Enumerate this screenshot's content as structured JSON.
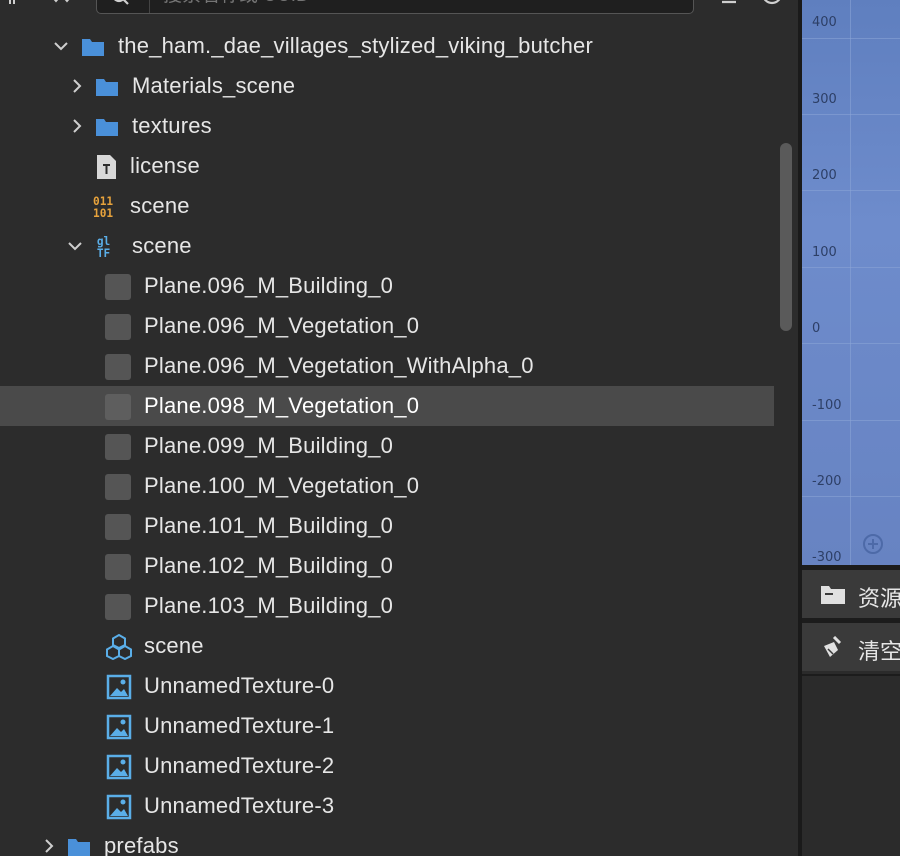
{
  "search": {
    "placeholder": "搜索名称或 UUID"
  },
  "tree": {
    "root_folder": "the_ham._dae_villages_stylized_viking_butcher",
    "materials_folder": "Materials_scene",
    "textures_folder": "textures",
    "license_file": "license",
    "binary_scene": "scene",
    "gltf_scene": "scene",
    "meshes": [
      "Plane.096_M_Building_0",
      "Plane.096_M_Vegetation_0",
      "Plane.096_M_Vegetation_WithAlpha_0",
      "Plane.098_M_Vegetation_0",
      "Plane.099_M_Building_0",
      "Plane.100_M_Vegetation_0",
      "Plane.101_M_Building_0",
      "Plane.102_M_Building_0",
      "Plane.103_M_Building_0"
    ],
    "prefab_scene": "scene",
    "textures": [
      "UnnamedTexture-0",
      "UnnamedTexture-1",
      "UnnamedTexture-2",
      "UnnamedTexture-3"
    ],
    "prefabs_folder": "prefabs"
  },
  "viewport": {
    "ticks": [
      "400",
      "300",
      "200",
      "100",
      "0",
      "-100",
      "-200",
      "-300"
    ]
  },
  "right_panel": {
    "assets_label": "资源",
    "clear_label": "清空"
  },
  "colors": {
    "folder": "#4a90d9",
    "selected_row": "#4a4a4a",
    "texture_icon": "#5aaee8",
    "binary_icon": "#e8a33c"
  }
}
